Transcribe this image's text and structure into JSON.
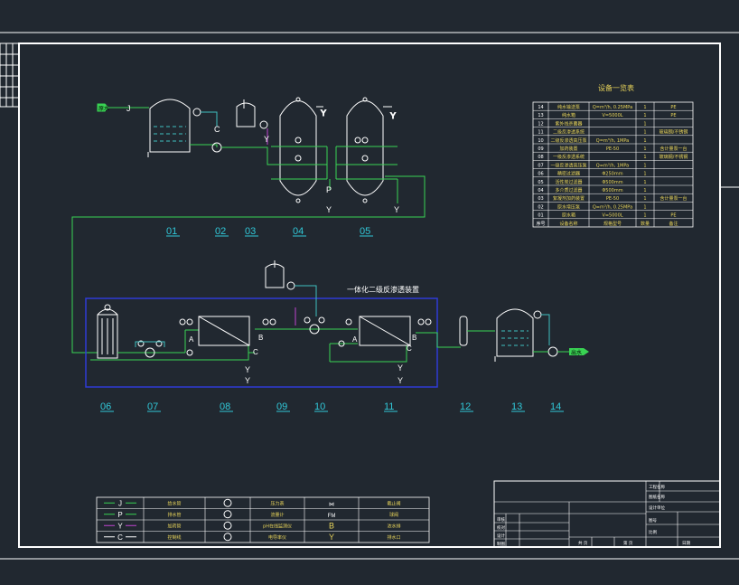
{
  "colors": {
    "background": "#212830",
    "frame": "#ffffff",
    "water_line_J": "#39d353",
    "dosing_line_Y": "#c044d0",
    "control_line_C": "#3fbfbf",
    "equipment": "#ffffff",
    "enclosure": "#2f3bd6",
    "label_cyan": "#31c8d8",
    "table_text": "#e8d45a",
    "title_text": "#ffffff"
  },
  "process_numbers": {
    "top": [
      "01",
      "02",
      "03",
      "04",
      "05"
    ],
    "bottom": [
      "06",
      "07",
      "08",
      "09",
      "10",
      "11",
      "12",
      "13",
      "14"
    ]
  },
  "enclosure_title": "一体化二级反渗透装置",
  "inlet_label": "原水",
  "outlet_label": "出水",
  "line_letters": {
    "J": "J",
    "C": "C",
    "Y": "Y",
    "P": "P",
    "A": "A",
    "B": "B"
  },
  "equipment_table": {
    "title": "设备一览表",
    "rows": [
      {
        "no": "14",
        "name": "纯水输送泵",
        "spec": "Q=m³/h, 0.25MPa",
        "qty": "1",
        "material": "PE"
      },
      {
        "no": "13",
        "name": "纯水箱",
        "spec": "V=5000L",
        "qty": "1",
        "material": "PE"
      },
      {
        "no": "12",
        "name": "紫外线杀菌器",
        "spec": "",
        "qty": "1",
        "material": ""
      },
      {
        "no": "11",
        "name": "二级反渗透系统",
        "spec": "",
        "qty": "1",
        "material": "玻璃钢/不锈钢"
      },
      {
        "no": "10",
        "name": "二级反渗透高压泵",
        "spec": "Q=m³/h, 1MPa",
        "qty": "1",
        "material": ""
      },
      {
        "no": "09",
        "name": "加药装置",
        "spec": "PE-50",
        "qty": "1",
        "material": "含计量泵一台"
      },
      {
        "no": "08",
        "name": "一级反渗透系统",
        "spec": "",
        "qty": "1",
        "material": "玻璃钢/不锈钢"
      },
      {
        "no": "07",
        "name": "一级反渗透高压泵",
        "spec": "Q=m³/h, 1MPa",
        "qty": "1",
        "material": ""
      },
      {
        "no": "06",
        "name": "精密过滤器",
        "spec": "Φ250mm",
        "qty": "1",
        "material": ""
      },
      {
        "no": "05",
        "name": "活性炭过滤器",
        "spec": "Φ500mm",
        "qty": "1",
        "material": ""
      },
      {
        "no": "04",
        "name": "多介质过滤器",
        "spec": "Φ500mm",
        "qty": "1",
        "material": ""
      },
      {
        "no": "03",
        "name": "絮凝剂加药装置",
        "spec": "PE-50",
        "qty": "1",
        "material": "含计量泵一台"
      },
      {
        "no": "02",
        "name": "原水增压泵",
        "spec": "Q=m³/h, 0.25MPa",
        "qty": "1",
        "material": ""
      },
      {
        "no": "01",
        "name": "原水箱",
        "spec": "V=5000L",
        "qty": "1",
        "material": "PE"
      },
      {
        "no": "序号",
        "name": "设备名称",
        "spec": "规格型号",
        "qty": "数量",
        "material": "备注"
      }
    ]
  },
  "legend": {
    "rows": [
      {
        "line": "J",
        "line_name": "给水管",
        "symbol_name": "压力表",
        "valve_symbol": "⋈",
        "valve_name": "截止阀"
      },
      {
        "line": "P",
        "line_name": "排水管",
        "symbol_name": "流量计",
        "valve_symbol": "FM",
        "valve_name": "球阀"
      },
      {
        "line": "Y",
        "line_name": "加药管",
        "symbol_name": "pH在线监测仪",
        "valve_symbol": "B",
        "valve_name": "浓水排"
      },
      {
        "line": "C",
        "line_name": "控制线",
        "symbol_name": "电导率仪",
        "valve_symbol": "Y",
        "valve_name": "排水口"
      }
    ],
    "ph_prefix": "pH"
  },
  "title_block": {
    "cells": [
      "工程名称",
      "图纸名称",
      "设计单位",
      "图号",
      "比例",
      "日期",
      "审核",
      "校对",
      "设计",
      "制图",
      "共 页",
      "第 页"
    ]
  }
}
